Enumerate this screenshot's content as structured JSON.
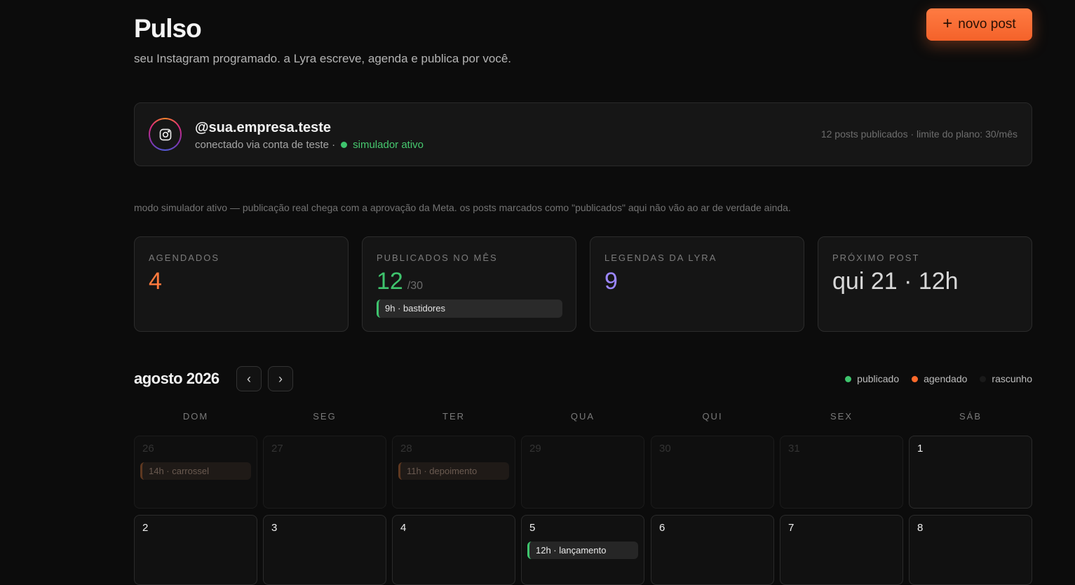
{
  "header": {
    "title": "Pulso",
    "subtitle": "seu Instagram programado. a Lyra escreve, agenda e publica por você.",
    "new_post_label": "novo post"
  },
  "account": {
    "handle": "@sua.empresa.teste",
    "connection": "conectado via conta de teste ·",
    "simulator": "simulador ativo",
    "plan_info": "12 posts publicados · limite do plano: 30/mês"
  },
  "notice": "modo simulador ativo — publicação real chega com a aprovação da Meta. os posts marcados como \"publicados\" aqui não vão ao ar de verdade ainda.",
  "stats": {
    "scheduled": {
      "label": "AGENDADOS",
      "value": "4",
      "color": "#ff7a3d"
    },
    "published": {
      "label": "PUBLICADOS NO MÊS",
      "value": "12",
      "suffix": "/30",
      "chip": "9h · bastidores",
      "color": "#3ec46d"
    },
    "captions": {
      "label": "LEGENDAS DA LYRA",
      "value": "9",
      "color": "#9b86ff"
    },
    "next": {
      "label": "PRÓXIMO POST",
      "value": "qui 21 · 12h",
      "color": "#d8d8d8"
    }
  },
  "calendar": {
    "month": "agosto 2026",
    "legend": [
      {
        "label": "publicado",
        "color": "#3ec46d"
      },
      {
        "label": "agendado",
        "color": "#ff6a2b"
      },
      {
        "label": "rascunho",
        "color": "#1a1a1a"
      }
    ],
    "weekdays": [
      "DOM",
      "SEG",
      "TER",
      "QUA",
      "QUI",
      "SEX",
      "SÁB"
    ],
    "weeks": [
      [
        {
          "day": "26",
          "out": true,
          "event": "14h · carrossel",
          "status": "scheduled"
        },
        {
          "day": "27",
          "out": true
        },
        {
          "day": "28",
          "out": true,
          "event": "11h · depoimento",
          "status": "scheduled"
        },
        {
          "day": "29",
          "out": true
        },
        {
          "day": "30",
          "out": true
        },
        {
          "day": "31",
          "out": true
        },
        {
          "day": "1"
        }
      ],
      [
        {
          "day": "2"
        },
        {
          "day": "3"
        },
        {
          "day": "4"
        },
        {
          "day": "5",
          "event": "12h · lançamento",
          "status": "published"
        },
        {
          "day": "6"
        },
        {
          "day": "7"
        },
        {
          "day": "8"
        }
      ]
    ]
  }
}
